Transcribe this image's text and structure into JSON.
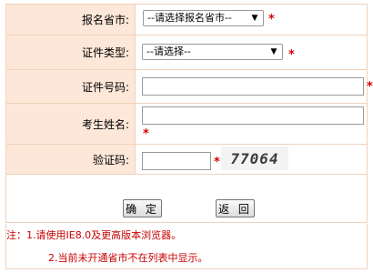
{
  "form": {
    "province": {
      "label": "报名省市:",
      "selected": "--请选择报名省市--"
    },
    "id_type": {
      "label": "证件类型:",
      "selected": "--请选择--"
    },
    "id_number": {
      "label": "证件号码:",
      "value": ""
    },
    "name": {
      "label": "考生姓名:",
      "value": ""
    },
    "captcha": {
      "label": "验证码:",
      "value": "",
      "image_text": "77064"
    },
    "required_mark": "*"
  },
  "buttons": {
    "confirm": "确 定",
    "back": "返 回"
  },
  "notes": {
    "line1": "注：1.请使用IE8.0及更高版本浏览器。",
    "line2": "2.当前未开通省市不在列表中显示。"
  },
  "colors": {
    "label_bg": "#fde7d8",
    "border": "#f0d2bc",
    "required": "#d60000",
    "note": "#c80000"
  }
}
